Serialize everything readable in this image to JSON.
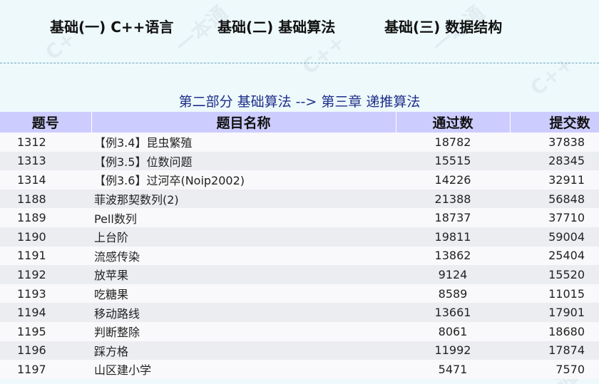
{
  "nav": {
    "items": [
      {
        "label": "基础(一) C++语言"
      },
      {
        "label": "基础(二) 基础算法"
      },
      {
        "label": "基础(三) 数据结构"
      }
    ]
  },
  "chapter_title": "第二部分 基础算法 --> 第三章 递推算法",
  "table": {
    "headers": {
      "id": "题号",
      "name": "题目名称",
      "accepted": "通过数",
      "submitted": "提交数"
    },
    "rows": [
      {
        "id": "1312",
        "name": "【例3.4】昆虫繁殖",
        "accepted": "18782",
        "submitted": "37838"
      },
      {
        "id": "1313",
        "name": "【例3.5】位数问题",
        "accepted": "15515",
        "submitted": "28345"
      },
      {
        "id": "1314",
        "name": "【例3.6】过河卒(Noip2002)",
        "accepted": "14226",
        "submitted": "32911"
      },
      {
        "id": "1188",
        "name": "菲波那契数列(2)",
        "accepted": "21388",
        "submitted": "56848"
      },
      {
        "id": "1189",
        "name": "Pell数列",
        "accepted": "18737",
        "submitted": "37710"
      },
      {
        "id": "1190",
        "name": "上台阶",
        "accepted": "19811",
        "submitted": "59004"
      },
      {
        "id": "1191",
        "name": "流感传染",
        "accepted": "13862",
        "submitted": "25404"
      },
      {
        "id": "1192",
        "name": "放苹果",
        "accepted": "9124",
        "submitted": "15520"
      },
      {
        "id": "1193",
        "name": "吃糖果",
        "accepted": "8589",
        "submitted": "11015"
      },
      {
        "id": "1194",
        "name": "移动路线",
        "accepted": "13661",
        "submitted": "17901"
      },
      {
        "id": "1195",
        "name": "判断整除",
        "accepted": "8061",
        "submitted": "18680"
      },
      {
        "id": "1196",
        "name": "踩方格",
        "accepted": "11992",
        "submitted": "17874"
      },
      {
        "id": "1197",
        "name": "山区建小学",
        "accepted": "5471",
        "submitted": "7570"
      }
    ]
  },
  "colors": {
    "header_bg": "#ccccff",
    "title_color": "#1d2f8a",
    "page_bg": "#eef9fb"
  }
}
